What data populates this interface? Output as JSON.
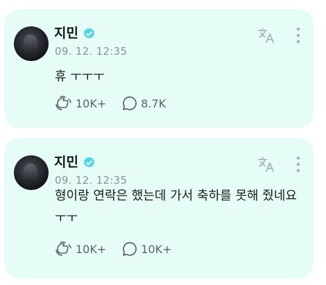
{
  "posts": [
    {
      "author": "지민",
      "timestamp": "09. 12. 12:35",
      "text": "휴 ㅜㅜㅜ",
      "likes": "10K+",
      "comments": "8.7K"
    },
    {
      "author": "지민",
      "timestamp": "09. 12. 12:35",
      "text": "형이랑 연락은 했는데 가서 축하를 못해 줬네요ㅜㅜ",
      "likes": "10K+",
      "comments": "10K+"
    }
  ],
  "colors": {
    "card_bg": "#e6fdf7",
    "accent": "#4fd6e6",
    "muted": "#8b9193"
  },
  "icons": {
    "verified": "verified-badge-icon",
    "translate": "translate-icon",
    "more": "more-vertical-icon",
    "like": "like-hands-icon",
    "comment": "comment-bubble-icon"
  }
}
